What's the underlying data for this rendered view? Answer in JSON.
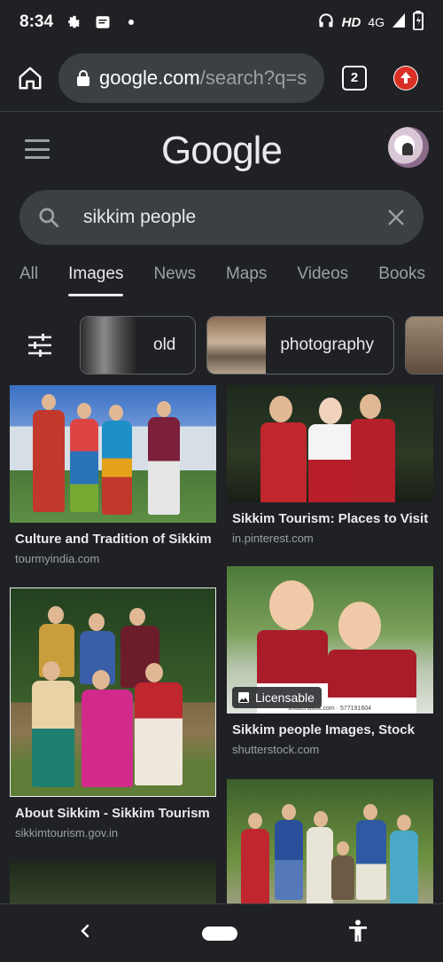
{
  "status_bar": {
    "time": "8:34",
    "hd": "HD",
    "network": "4G",
    "icons": [
      "settings-icon",
      "message-icon",
      "dot-icon",
      "headphones-icon",
      "signal-icon",
      "battery-icon"
    ]
  },
  "browser": {
    "url_host": "google.com",
    "url_path": "/search?q=s",
    "tab_count": "2"
  },
  "google": {
    "logo": "Google",
    "query": "sikkim people"
  },
  "tabs": [
    {
      "label": "All"
    },
    {
      "label": "Images"
    },
    {
      "label": "News"
    },
    {
      "label": "Maps"
    },
    {
      "label": "Videos"
    },
    {
      "label": "Books"
    }
  ],
  "chips": [
    {
      "label": "old"
    },
    {
      "label": "photography"
    }
  ],
  "results": [
    {
      "title": "Culture and Tradition of Sikkim",
      "source": "tourmyindia.com"
    },
    {
      "title": "Sikkim Tourism: Places to Visit",
      "source": "in.pinterest.com"
    },
    {
      "title": "About Sikkim - Sikkim Tourism",
      "source": "sikkimtourism.gov.in"
    },
    {
      "title": "Sikkim people Images, Stock",
      "source": "shutterstock.com",
      "badge": "Licensable",
      "watermark": "shutterstock.com · 577191604"
    }
  ],
  "colors": {
    "background": "#202124",
    "surface": "#3c4043",
    "text": "#e8eaed",
    "muted": "#9aa0a6",
    "update_red": "#d93025"
  }
}
